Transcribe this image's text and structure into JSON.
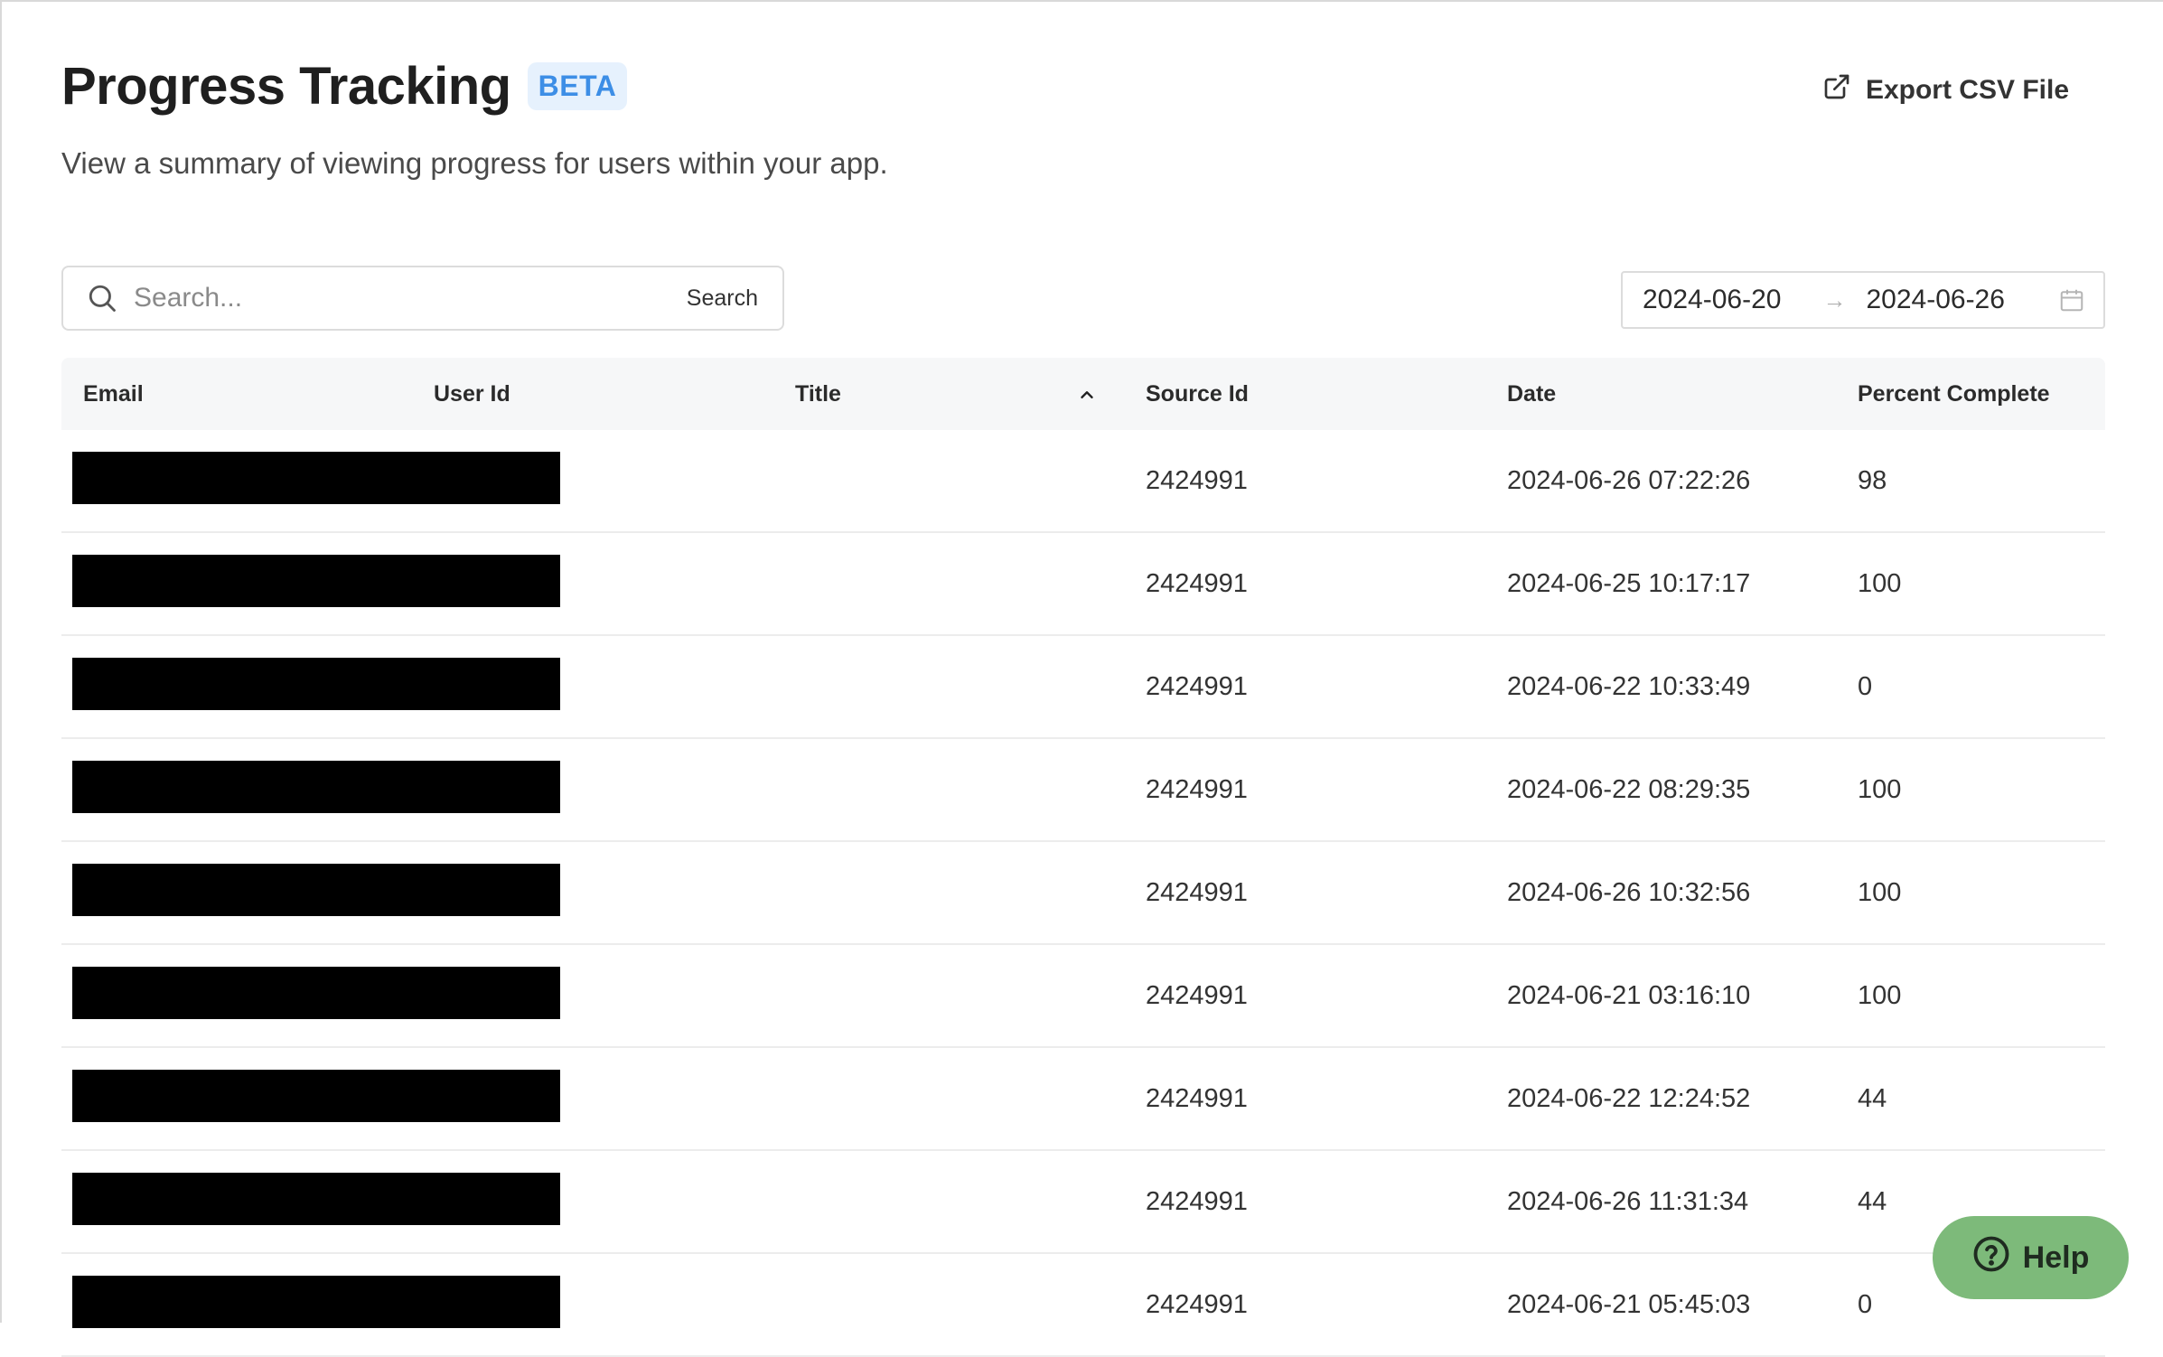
{
  "header": {
    "title": "Progress Tracking",
    "badge": "BETA",
    "subtitle": "View a summary of viewing progress for users within your app.",
    "export_label": "Export CSV File"
  },
  "search": {
    "placeholder": "Search...",
    "button_label": "Search"
  },
  "date_range": {
    "start": "2024-06-20",
    "separator": "→",
    "end": "2024-06-26"
  },
  "table": {
    "columns": {
      "email": "Email",
      "user_id": "User Id",
      "title": "Title",
      "source_id": "Source Id",
      "date": "Date",
      "percent": "Percent Complete"
    },
    "rows": [
      {
        "source_id": "2424991",
        "date": "2024-06-26 07:22:26",
        "percent": "98"
      },
      {
        "source_id": "2424991",
        "date": "2024-06-25 10:17:17",
        "percent": "100"
      },
      {
        "source_id": "2424991",
        "date": "2024-06-22 10:33:49",
        "percent": "0"
      },
      {
        "source_id": "2424991",
        "date": "2024-06-22 08:29:35",
        "percent": "100"
      },
      {
        "source_id": "2424991",
        "date": "2024-06-26 10:32:56",
        "percent": "100"
      },
      {
        "source_id": "2424991",
        "date": "2024-06-21 03:16:10",
        "percent": "100"
      },
      {
        "source_id": "2424991",
        "date": "2024-06-22 12:24:52",
        "percent": "44"
      },
      {
        "source_id": "2424991",
        "date": "2024-06-26 11:31:34",
        "percent": "44"
      },
      {
        "source_id": "2424991",
        "date": "2024-06-21 05:45:03",
        "percent": "0"
      }
    ]
  },
  "help": {
    "label": "Help"
  },
  "colors": {
    "accent_blue": "#3d8ee6",
    "badge_bg": "#e6f1fd",
    "help_green": "#7dba7a",
    "header_bg": "#f6f7f8",
    "redaction": "#000000"
  }
}
